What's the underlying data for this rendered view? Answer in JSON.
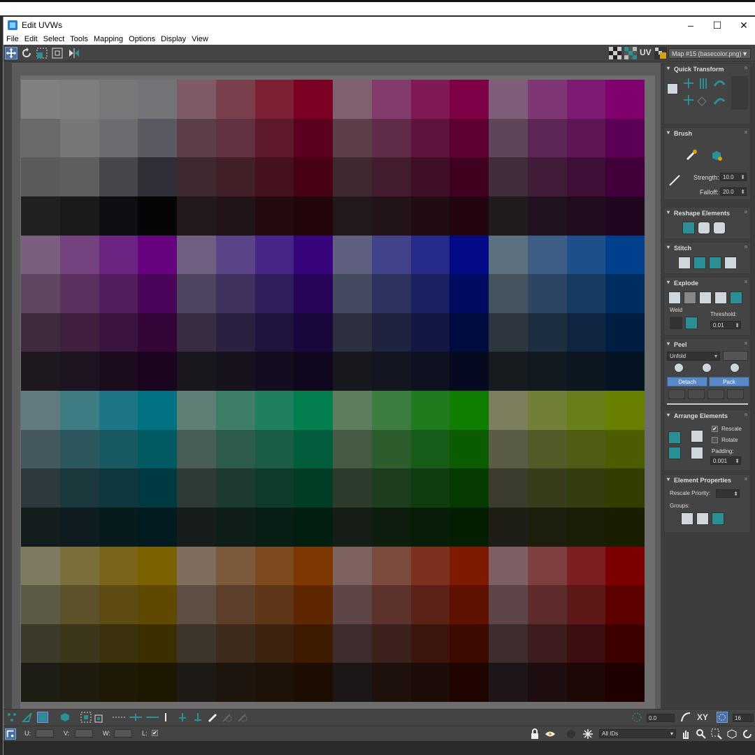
{
  "window": {
    "title": "Edit UVWs",
    "minimize": "–",
    "maximize": "☐",
    "close": "✕"
  },
  "menu": [
    "File",
    "Edit",
    "Select",
    "Tools",
    "Mapping",
    "Options",
    "Display",
    "View"
  ],
  "toolbar": {
    "uv_label": "UV",
    "map_select": "Map #15 (basecolor.png)"
  },
  "texture_colors": [
    [
      "#808080",
      "#7e7e7e",
      "#787878",
      "#737478",
      "#7f5a69",
      "#7b404d",
      "#7e2034",
      "#7c0023",
      "#80616f",
      "#823b6b",
      "#7f1a54",
      "#7e0045",
      "#7e5e79",
      "#7e3675",
      "#7e1a72",
      "#80006e"
    ],
    [
      "#6a6a6a",
      "#777777",
      "#6c6c72",
      "#5a5a62",
      "#5d3d47",
      "#633240",
      "#5e1a2c",
      "#5c0021",
      "#5d3f4a",
      "#612b4a",
      "#5f1440",
      "#5f0033",
      "#5f455a",
      "#5d2656",
      "#5e1555",
      "#5c0055"
    ],
    [
      "#5b5b5b",
      "#5e5e5e",
      "#46464c",
      "#2f2f38",
      "#3e2a2e",
      "#412127",
      "#45111c",
      "#470014",
      "#3f2a31",
      "#431c2f",
      "#3f0f28",
      "#410020",
      "#3f2d3c",
      "#411c38",
      "#3f0f37",
      "#41003a"
    ],
    [
      "#212121",
      "#1a1a1a",
      "#0e0e12",
      "#050505",
      "#221a1b",
      "#221518",
      "#230b0f",
      "#22050a",
      "#21191b",
      "#23131a",
      "#210c13",
      "#220511",
      "#211a1f",
      "#211220",
      "#1f0c1f",
      "#21061f"
    ],
    [
      "#7b5f7f",
      "#754280",
      "#6c2482",
      "#68037f",
      "#715f82",
      "#5a4386",
      "#452585",
      "#37047e",
      "#5f607f",
      "#41428a",
      "#262b89",
      "#020a86",
      "#5d7080",
      "#3f5e86",
      "#1d508a",
      "#003f8b"
    ],
    [
      "#5f4560",
      "#5c3060",
      "#531e5d",
      "#4a0459",
      "#4f4561",
      "#41315f",
      "#311e5c",
      "#260558",
      "#444a5f",
      "#2f3360",
      "#1a2163",
      "#000a60",
      "#45535e",
      "#2c4562",
      "#173b62",
      "#002d60"
    ],
    [
      "#3f2b3f",
      "#3f203f",
      "#3a133e",
      "#330539",
      "#372c40",
      "#2b2040",
      "#20133e",
      "#19073c",
      "#2d3040",
      "#1f2340",
      "#121843",
      "#000b40",
      "#2d363f",
      "#1d2e41",
      "#0f2642",
      "#001e42"
    ],
    [
      "#1f1720",
      "#1e1320",
      "#1d0c1e",
      "#1b051e",
      "#1a171e",
      "#18121f",
      "#140c1f",
      "#10061e",
      "#17191f",
      "#131520",
      "#0e1220",
      "#050a20",
      "#161b1f",
      "#121a21",
      "#0c1721",
      "#051422"
    ],
    [
      "#607c80",
      "#3d7c82",
      "#1d7586",
      "#017283",
      "#5f7f76",
      "#3e7e66",
      "#1f7f5e",
      "#017f4f",
      "#5e7e5f",
      "#3c7e3f",
      "#1e7c1e",
      "#0f7d00",
      "#7c7e5e",
      "#727f36",
      "#697f1b",
      "#687f00"
    ],
    [
      "#45585e",
      "#2c575e",
      "#185861",
      "#015a61",
      "#475d55",
      "#2e5b4a",
      "#185d44",
      "#015d3b",
      "#465b44",
      "#2d5c2d",
      "#185c19",
      "#0b5c00",
      "#5a5c45",
      "#535c28",
      "#4e5d13",
      "#4c5c00"
    ],
    [
      "#2c393d",
      "#1b393d",
      "#0e373f",
      "#013941",
      "#2e3a35",
      "#1d3b2f",
      "#0f3b2c",
      "#013c24",
      "#2d3b2d",
      "#1e3d1f",
      "#103d10",
      "#053b00",
      "#3b3c2e",
      "#383c1a",
      "#333d0c",
      "#323d00"
    ],
    [
      "#151c1e",
      "#0f1c1f",
      "#071b1e",
      "#011b20",
      "#171d1a",
      "#0f1e16",
      "#081e14",
      "#011e10",
      "#161c16",
      "#0f1d0f",
      "#081d07",
      "#031e00",
      "#1e1e16",
      "#1d1e0d",
      "#1b1e06",
      "#191e00"
    ],
    [
      "#7e7a60",
      "#7b6f3b",
      "#7c641b",
      "#7c6101",
      "#7f6d60",
      "#7e5a3c",
      "#7e4a1f",
      "#7e3702",
      "#7d6260",
      "#7d4a3e",
      "#7d301e",
      "#7e1a01",
      "#7e6064",
      "#7d3f3f",
      "#7c1f20",
      "#7c0000"
    ],
    [
      "#5c5944",
      "#5d522b",
      "#5e4c14",
      "#5f4800",
      "#5e4e44",
      "#5e3f2b",
      "#5e3516",
      "#5e2701",
      "#5e4646",
      "#5c332c",
      "#5c2217",
      "#5f1000",
      "#5e4648",
      "#5e2c2c",
      "#5e1717",
      "#5c0000"
    ],
    [
      "#3d3a2c",
      "#3c361b",
      "#3b310c",
      "#3b2f00",
      "#3d342c",
      "#3d2a1c",
      "#3d220e",
      "#3e1a01",
      "#3d2d2d",
      "#3d211c",
      "#3c160e",
      "#3d0a00",
      "#3e2d2f",
      "#3d1d1e",
      "#3c0e0f",
      "#3d0000"
    ],
    [
      "#1e1d16",
      "#1f1b0e",
      "#1f1a08",
      "#1e1700",
      "#1e1a16",
      "#1e150e",
      "#1e1107",
      "#1e0d01",
      "#1e1717",
      "#1e110e",
      "#1e0c08",
      "#1f0501",
      "#1e1618",
      "#1e0e0f",
      "#1e0707",
      "#1e0000"
    ]
  ],
  "panel": {
    "quick_transform": {
      "title": "Quick Transform"
    },
    "brush": {
      "title": "Brush",
      "strength_label": "Strength:",
      "strength_value": "10.0",
      "falloff_label": "Falloff:",
      "falloff_value": "20.0"
    },
    "reshape": {
      "title": "Reshape Elements"
    },
    "stitch": {
      "title": "Stitch"
    },
    "explode": {
      "title": "Explode",
      "weld_label": "Weld",
      "threshold_label": "Threshold:",
      "threshold_value": "0.01"
    },
    "peel": {
      "title": "Peel",
      "unfold_value": "Unfold",
      "detach_label": "Detach",
      "pack_label": "Pack"
    },
    "arrange": {
      "title": "Arrange Elements",
      "rescale_label": "Rescale",
      "rescale_checked": "✔",
      "rotate_label": "Rotate",
      "padding_label": "Padding:",
      "padding_value": "0.001"
    },
    "element_props": {
      "title": "Element Properties",
      "rescale_priority_label": "Rescale Priority:",
      "groups_label": "Groups:"
    }
  },
  "statusbar": {
    "u_label": "U:",
    "v_label": "V:",
    "w_label": "W:",
    "l_label": "L:",
    "l_checked": "✔",
    "angle_value": "0.0",
    "xy_label": "XY",
    "grid_value": "16",
    "ids_value": "All IDs"
  },
  "colors": {
    "accent": "#2b8f96",
    "panel_bg": "#444444",
    "button_blue": "#5a89c8"
  }
}
